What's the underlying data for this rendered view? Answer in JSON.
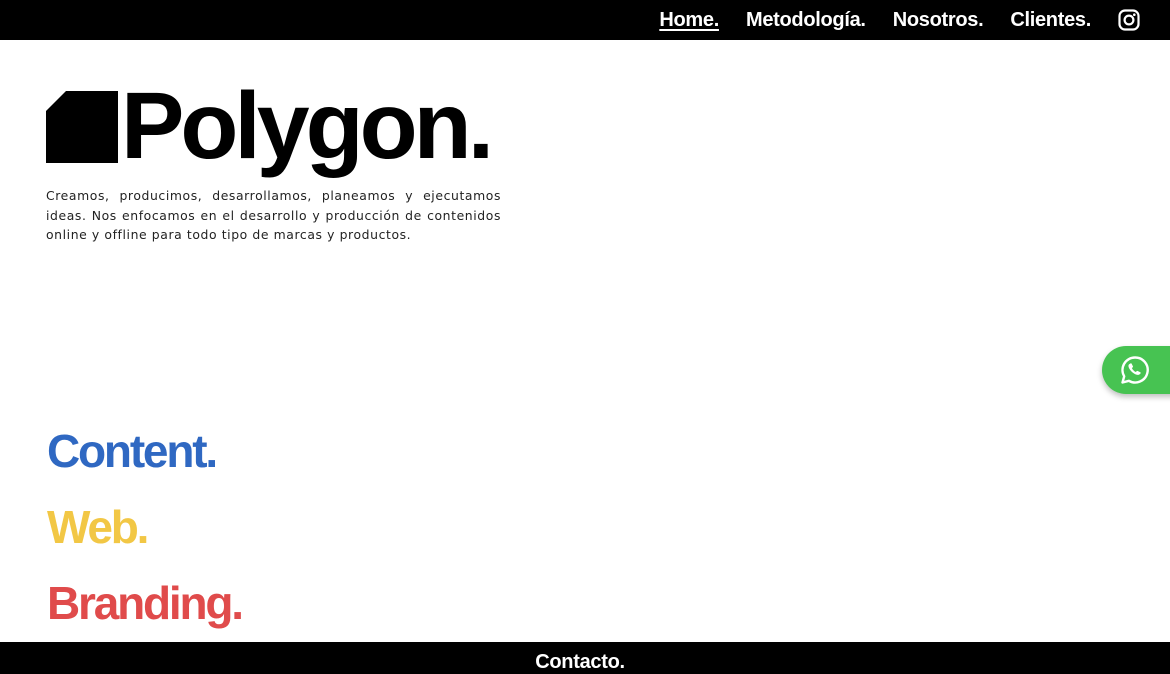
{
  "nav": {
    "items": [
      {
        "label": "Home.",
        "active": true
      },
      {
        "label": "Metodología.",
        "active": false
      },
      {
        "label": "Nosotros.",
        "active": false
      },
      {
        "label": "Clientes.",
        "active": false
      }
    ],
    "social_icon": "instagram-icon"
  },
  "hero": {
    "brand": "Polygon.",
    "description": "Creamos, producimos, desarrollamos, planeamos y ejecutamos ideas. Nos enfocamos en el desarrollo y producción de contenidos online y offline para todo tipo de marcas y productos."
  },
  "services": [
    {
      "label": "Content.",
      "color": "#2f68c2"
    },
    {
      "label": "Web.",
      "color": "#f2c745"
    },
    {
      "label": "Branding.",
      "color": "#e04b4b"
    }
  ],
  "whatsapp": {
    "icon": "whatsapp-icon",
    "color": "#47c352"
  },
  "footer": {
    "contact_label": "Contacto."
  }
}
